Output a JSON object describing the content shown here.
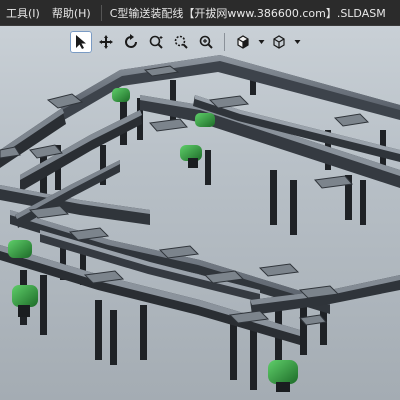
{
  "menubar": {
    "items": [
      {
        "label": "工具(I)"
      },
      {
        "label": "帮助(H)"
      }
    ],
    "document_title": "C型输送装配线【开拔网www.386600.com】.SLDASM"
  },
  "heads_up_toolbar": {
    "tools": [
      {
        "icon": "select-arrow-icon",
        "active": true
      },
      {
        "icon": "pan-icon"
      },
      {
        "icon": "rotate-icon"
      },
      {
        "icon": "zoom-to-fit-icon"
      },
      {
        "icon": "zoom-area-icon"
      },
      {
        "icon": "zoom-in-out-icon"
      },
      {
        "icon": "display-style-icon",
        "dropdown": true
      },
      {
        "icon": "view-orientation-cube-icon",
        "dropdown": true
      }
    ]
  },
  "colors": {
    "rail_dark": "#2a2e33",
    "rail_mid": "#4a5058",
    "rail_light": "#8b939c",
    "motor_green": "#2f8a3a",
    "motor_green_light": "#4bbf57",
    "leg_dark": "#1f2226"
  }
}
